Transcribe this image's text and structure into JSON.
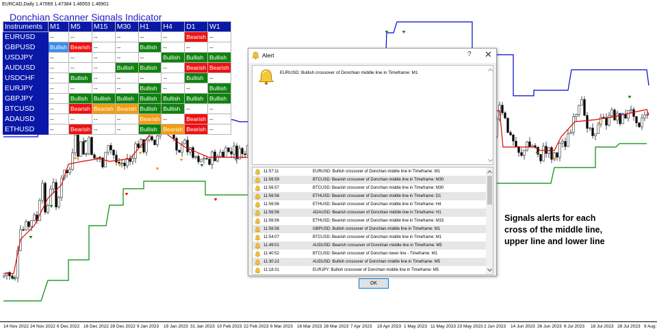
{
  "window": {
    "title": "EURCAD,Daily  1.47069 1.47384 1.46553 1.46901"
  },
  "scanner": {
    "title": "Donchian Scanner Signals Indicator",
    "headers": [
      "Instruments",
      "M1",
      "M5",
      "M15",
      "M30",
      "H1",
      "H4",
      "D1",
      "W1"
    ],
    "rows": [
      {
        "name": "EURUSD",
        "cells": [
          "--",
          "--",
          "--",
          "--",
          "--",
          "--",
          "Bearish",
          "--"
        ]
      },
      {
        "name": "GBPUSD",
        "cells": [
          "Bullish",
          "Bearish",
          "--",
          "--",
          "Bullish",
          "--",
          "--",
          "--"
        ]
      },
      {
        "name": "USDJPY",
        "cells": [
          "--",
          "--",
          "--",
          "--",
          "--",
          "Bullish",
          "Bullish",
          "Bullish"
        ]
      },
      {
        "name": "AUDUSD",
        "cells": [
          "--",
          "--",
          "--",
          "Bullish",
          "Bullish",
          "--",
          "Bearish",
          "Bearish"
        ]
      },
      {
        "name": "USDCHF",
        "cells": [
          "--",
          "Bullish",
          "--",
          "--",
          "--",
          "--",
          "Bullish",
          "--"
        ]
      },
      {
        "name": "EURJPY",
        "cells": [
          "--",
          "--",
          "--",
          "--",
          "Bullish",
          "--",
          "--",
          "Bullish"
        ]
      },
      {
        "name": "GBPJPY",
        "cells": [
          "--",
          "Bullish",
          "Bullish",
          "Bullish",
          "Bullish",
          "Bullish",
          "Bullish",
          "Bullish"
        ]
      },
      {
        "name": "BTCUSD",
        "cells": [
          "--",
          "Bearish",
          "Bearish",
          "Bearish",
          "Bullish",
          "Bullish",
          "--",
          "--"
        ]
      },
      {
        "name": "ADAUSD",
        "cells": [
          "--",
          "--",
          "--",
          "--",
          "Bearish",
          "--",
          "Bearish",
          "--"
        ]
      },
      {
        "name": "ETHUSD",
        "cells": [
          "--",
          "Bearish",
          "--",
          "--",
          "Bullish",
          "Bearish",
          "Bearish",
          "--"
        ]
      }
    ]
  },
  "colors": {
    "bullish": "#0f820f",
    "bearish": "#ee1111",
    "bullish_m1": "#3e8de8",
    "bearish_orange": "#f39c12",
    "header": "#0a18a8",
    "upper": "#0000cc",
    "middle": "#dd0000",
    "lower": "#008800"
  },
  "cell_styles": [
    [
      "",
      "",
      "",
      "",
      "",
      "",
      "bear",
      ""
    ],
    [
      "bullb",
      "bear",
      "",
      "",
      "bull",
      "",
      "",
      ""
    ],
    [
      "",
      "",
      "",
      "",
      "",
      "bull",
      "bull",
      "bull"
    ],
    [
      "",
      "",
      "",
      "bull",
      "bull",
      "",
      "bear",
      "bear"
    ],
    [
      "",
      "bull",
      "",
      "",
      "",
      "",
      "bull",
      ""
    ],
    [
      "",
      "",
      "",
      "",
      "bull",
      "",
      "",
      "bull"
    ],
    [
      "",
      "bull",
      "bull",
      "bull",
      "bull",
      "bull",
      "bull",
      "bull"
    ],
    [
      "",
      "bear",
      "bearo",
      "bearo",
      "bull",
      "bull",
      "",
      ""
    ],
    [
      "",
      "",
      "",
      "",
      "bearo",
      "",
      "bear",
      ""
    ],
    [
      "",
      "bear",
      "",
      "",
      "bull",
      "bearo",
      "bear",
      ""
    ]
  ],
  "alert": {
    "title": "Alert",
    "help": "?",
    "close": "✕",
    "message": "EURUSD: Bullish crossover of Donchian middle line in Timeframe: M1",
    "ok_label": "OK",
    "history": [
      {
        "time": "11:57:11",
        "msg": "EURUSD: Bullish crossover of Donchian middle line in Timeframe: M1"
      },
      {
        "time": "11:56:59",
        "msg": "BTCUSD: Bearish crossover of Donchian middle line in Timeframe: M30"
      },
      {
        "time": "11:56:57",
        "msg": "BTCUSD: Bearish crossover of Donchian middle line in Timeframe: M30"
      },
      {
        "time": "11:56:56",
        "msg": "ETHUSD: Bearish crossover of Donchian middle line in Timeframe: D1"
      },
      {
        "time": "11:56:56",
        "msg": "ETHUSD: Bearish crossover of Donchian middle line in Timeframe: H4"
      },
      {
        "time": "11:56:56",
        "msg": "ADAUSD: Bearish crossover of Donchian middle line in Timeframe: H1"
      },
      {
        "time": "11:56:56",
        "msg": "ETHUSD: Bearish crossover of Donchian middle line in Timeframe: M15"
      },
      {
        "time": "11:56:56",
        "msg": "GBPUSD: Bullish crossover of Donchian middle line in Timeframe: M1"
      },
      {
        "time": "11:54:07",
        "msg": "BTCUSD: Bearish crossover of Donchian middle line in Timeframe: M1"
      },
      {
        "time": "11:49:01",
        "msg": "AUDUSD: Bearish crossover of Donchian middle line in Timeframe: M5"
      },
      {
        "time": "11:40:52",
        "msg": "BTCUSD: Bearish crossover of Donchian lower line  - Timeframe: M1"
      },
      {
        "time": "11:30:22",
        "msg": "AUDUSD: Bullish crossover of Donchian middle line in Timeframe: M5"
      },
      {
        "time": "11:18:31",
        "msg": "EURJPY: Bullish crossover of Donchian middle line in Timeframe: M5"
      }
    ]
  },
  "annotation": {
    "line1": "Signals alerts for each",
    "line2": "cross of the middle line,",
    "line3": "upper line and lower line"
  },
  "time_axis": {
    "labels": [
      "14 Nov 2022",
      "24 Nov 2022",
      "6 Dec 2022",
      "16 Dec 2022",
      "28 Dec 2022",
      "9 Jan 2023",
      "19 Jan 2023",
      "31 Jan 2023",
      "10 Feb 2023",
      "22 Feb 2023",
      "6 Mar 2023",
      "16 Mar 2023",
      "28 Mar 2023",
      "7 Apr 2023",
      "19 Apr 2023",
      "1 May 2023",
      "11 May 2023",
      "23 May 2023",
      "2 Jun 2023",
      "14 Jun 2023",
      "26 Jun 2023",
      "6 Jul 2023",
      "18 Jul 2023",
      "28 Jul 2023",
      "9 Aug 2023"
    ]
  }
}
